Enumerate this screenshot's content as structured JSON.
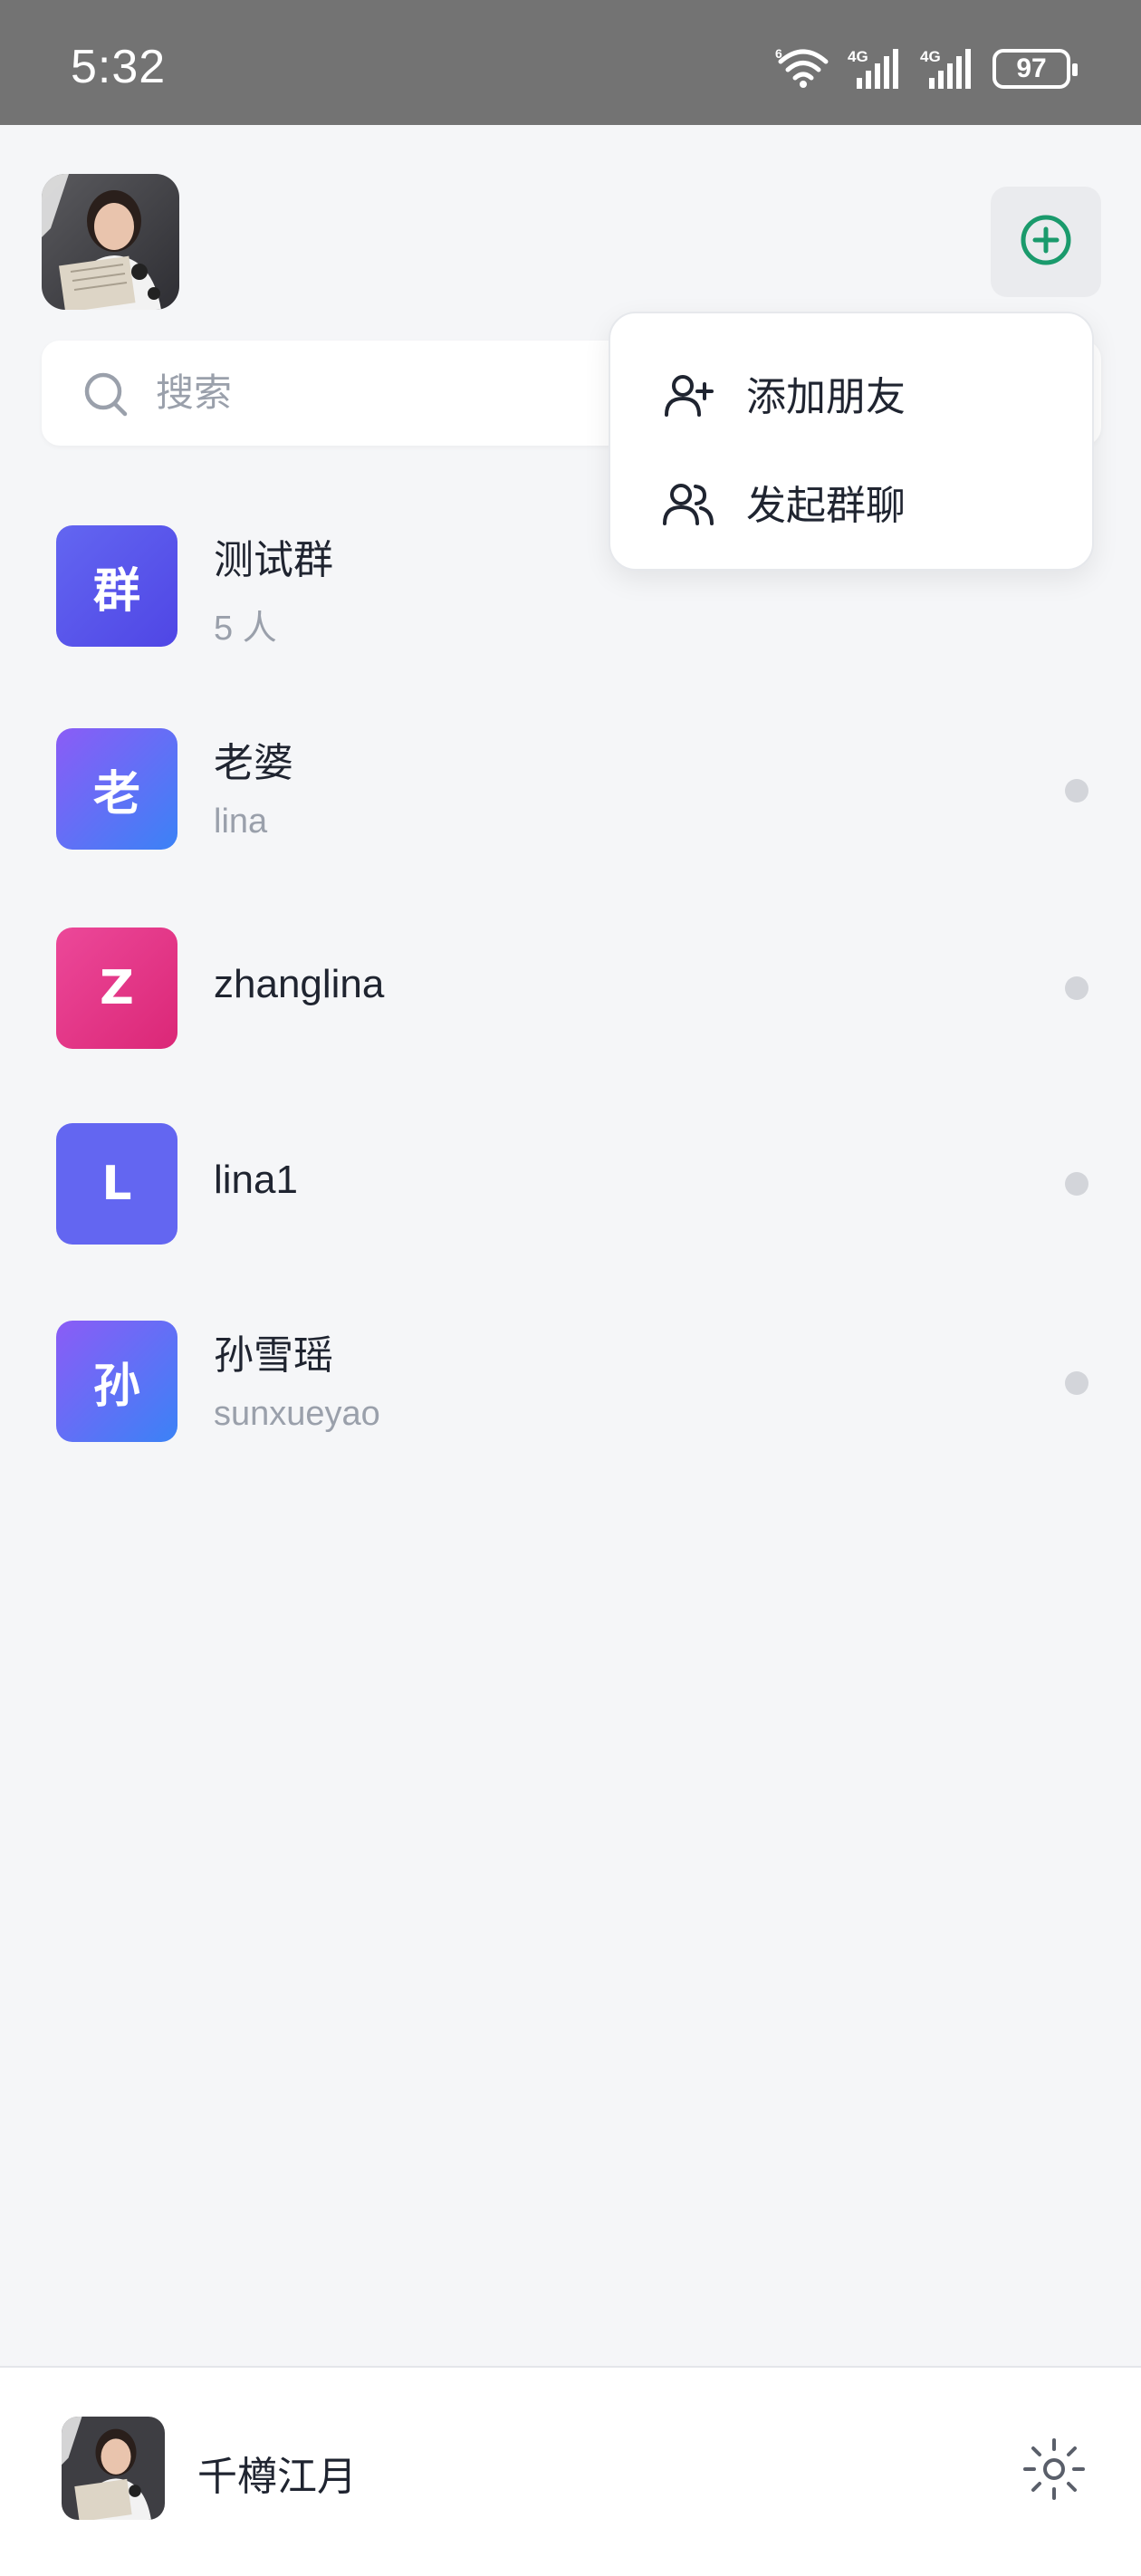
{
  "status_bar": {
    "time": "5:32",
    "network_labels": [
      "6",
      "4G",
      "4G"
    ],
    "battery": "97"
  },
  "header": {
    "avatar_icon": "user-photo",
    "add_icon": "plus-circle-icon",
    "accent_color": "#1a9a6c"
  },
  "search": {
    "placeholder": "搜索"
  },
  "menu": {
    "items": [
      {
        "label": "添加朋友",
        "icon": "add-user-icon"
      },
      {
        "label": "发起群聊",
        "icon": "group-icon"
      }
    ]
  },
  "conversations": [
    {
      "initial": "群",
      "name": "测试群",
      "sub": "5 人",
      "color_from": "#6366f1",
      "color_to": "#4f46e5"
    },
    {
      "initial": "老",
      "name": "老婆",
      "sub": "lina",
      "color_from": "#8b5cf6",
      "color_to": "#3b82f6"
    },
    {
      "initial": "Z",
      "name": "zhanglina",
      "sub": "",
      "color_from": "#ec4899",
      "color_to": "#db2777"
    },
    {
      "initial": "L",
      "name": "lina1",
      "sub": "",
      "color_from": "#6366f1",
      "color_to": "#6366f1"
    },
    {
      "initial": "孙",
      "name": "孙雪瑶",
      "sub": "sunxueyao",
      "color_from": "#8b5cf6",
      "color_to": "#3b82f6"
    }
  ],
  "bottom": {
    "username": "千樽江月",
    "settings_icon": "gear-icon"
  }
}
